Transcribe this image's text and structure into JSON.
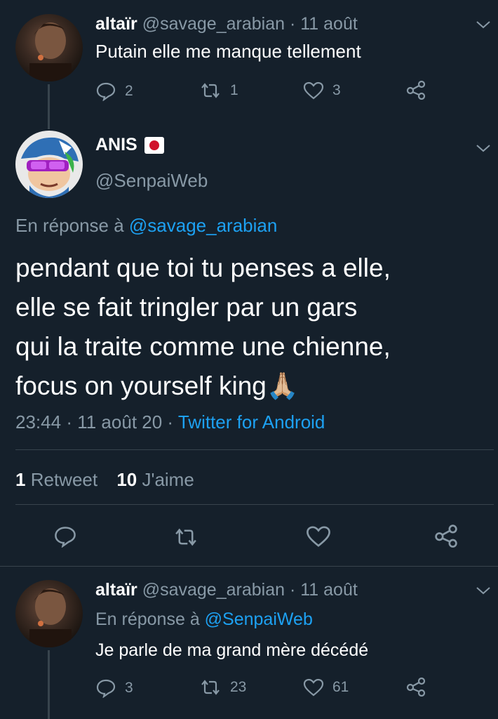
{
  "tweet1": {
    "display_name": "altaïr",
    "handle": "@savage_arabian",
    "sep": "·",
    "date": "11 août",
    "text": "Putain elle me manque tellement",
    "replies": "2",
    "retweets": "1",
    "likes": "3"
  },
  "main": {
    "display_name": "ANIS",
    "handle": "@SenpaiWeb",
    "reply_prefix": "En réponse à",
    "reply_to": "@savage_arabian",
    "text_lines": [
      "pendant que toi tu penses a elle,",
      "elle se fait tringler par un gars",
      "qui la traite comme une chienne,",
      "focus on yourself king"
    ],
    "emoji": "🙏🏼",
    "time": "23:44",
    "sep": "·",
    "date": "11 août 20",
    "source": "Twitter for Android",
    "retweet_count": "1",
    "retweet_label": "Retweet",
    "like_count": "10",
    "like_label": "J'aime"
  },
  "tweet3": {
    "display_name": "altaïr",
    "handle": "@savage_arabian",
    "sep": "·",
    "date": "11 août",
    "reply_prefix": "En réponse à",
    "reply_to": "@SenpaiWeb",
    "text": "Je parle de ma grand mère décédé",
    "replies": "3",
    "retweets": "23",
    "likes": "61"
  },
  "colors": {
    "background": "#15202b",
    "muted": "#8899a6",
    "link": "#1da1f2",
    "divider": "#38444d"
  }
}
